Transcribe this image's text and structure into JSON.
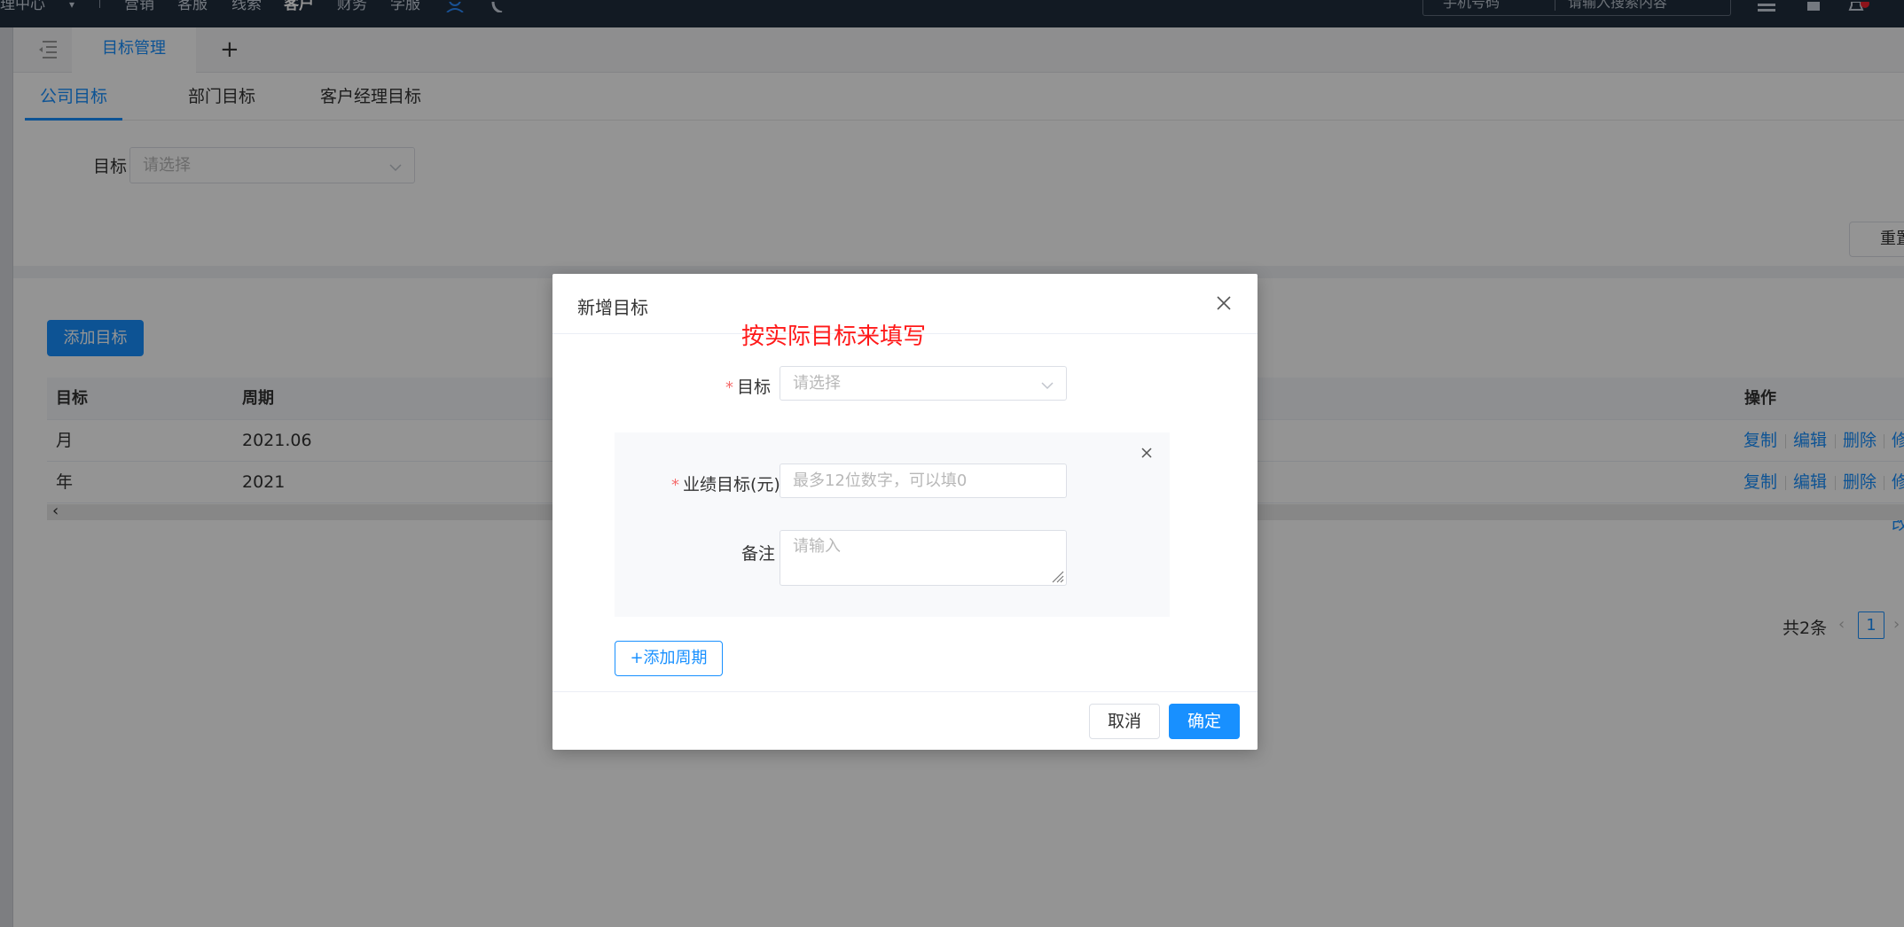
{
  "topnav": {
    "items": [
      {
        "label": "理中心"
      },
      {
        "label": "营销"
      },
      {
        "label": "客服"
      },
      {
        "label": "线索"
      },
      {
        "label": "客户"
      },
      {
        "label": "财务"
      },
      {
        "label": "学服"
      }
    ],
    "search_select": "手机号码",
    "search_placeholder": "请输入搜索内容"
  },
  "tabbar": {
    "active_tab": "目标管理",
    "add_tab": "+"
  },
  "subtabs": [
    {
      "label": "公司目标",
      "active": true
    },
    {
      "label": "部门目标",
      "active": false
    },
    {
      "label": "客户经理目标",
      "active": false
    }
  ],
  "filter": {
    "label": "目标",
    "placeholder": "请选择"
  },
  "reset_button": "重置",
  "add_button": "添加目标",
  "table": {
    "columns": [
      "目标",
      "周期",
      "操作"
    ],
    "rows": [
      {
        "target": "月",
        "period": "2021.06"
      },
      {
        "target": "年",
        "period": "2021"
      }
    ],
    "row_actions": [
      "复制",
      "编辑",
      "删除",
      "修改"
    ]
  },
  "pagination": {
    "total": "共2条",
    "page": "1"
  },
  "modal": {
    "title": "新增目标",
    "hint": "按实际目标来填写",
    "target_label": "目标",
    "target_placeholder": "请选择",
    "amount_label": "业绩目标(元)",
    "amount_placeholder": "最多12位数字，可以填0",
    "note_label": "备注",
    "note_placeholder": "请输入",
    "add_period": "+添加周期",
    "cancel": "取消",
    "ok": "确定"
  },
  "colors": {
    "primary": "#1890ff",
    "hint_red": "#ff1a1a",
    "nav_bg": "#1f2d3d"
  }
}
